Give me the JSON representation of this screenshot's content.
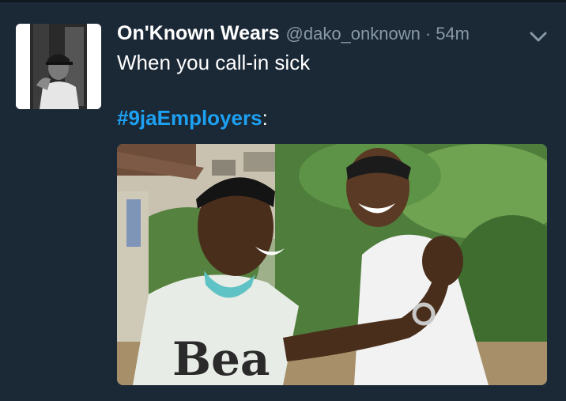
{
  "tweet": {
    "display_name": "On'Known Wears",
    "handle": "@dako_onknown",
    "separator": "·",
    "timestamp": "54m",
    "text_line1": "When you call-in sick",
    "hashtag": "#9jaEmployers",
    "after_hashtag": ":",
    "shirt_print": "Bea"
  },
  "icons": {
    "menu": "chevron-down-icon"
  },
  "colors": {
    "background": "#1b2836",
    "hashtag": "#1da1f2",
    "muted": "#8899a6"
  }
}
